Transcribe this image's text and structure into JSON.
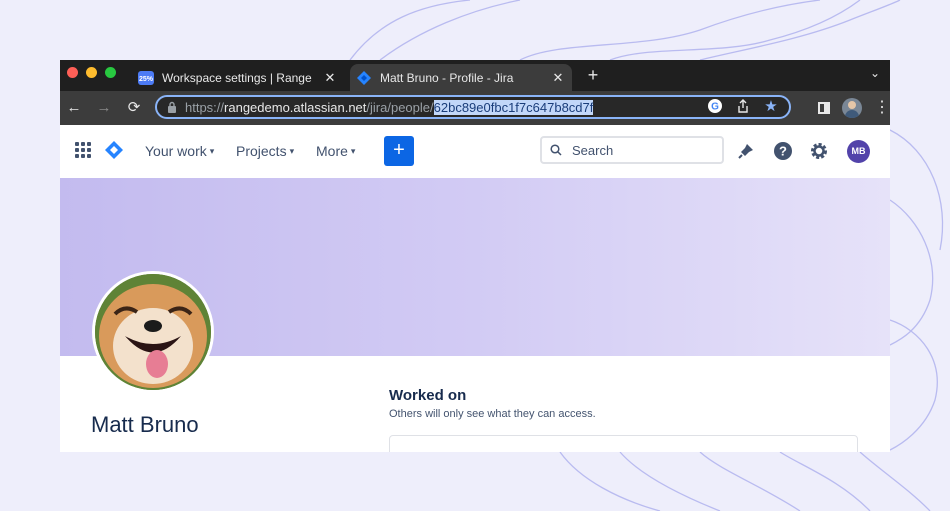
{
  "browser": {
    "tabs": [
      {
        "title": "Workspace settings | Range",
        "favicon": "range-logo-icon",
        "close": "✕"
      },
      {
        "title": "Matt Bruno - Profile - Jira",
        "favicon": "jira-logo-icon",
        "close": "✕"
      }
    ],
    "new_tab": "+",
    "tab_search": "⌄",
    "url": {
      "scheme": "https://",
      "host": "rangedemo.atlassian.net",
      "path": "/jira/people/",
      "selected": "62bc89e0fbc1f7c647b8cd7f"
    },
    "colors": {
      "tab_strip": "#1f1f1f",
      "toolbar": "#3c3c3c",
      "omnibox_border": "#8ab4f8"
    }
  },
  "jira_nav": {
    "your_work": "Your work",
    "projects": "Projects",
    "more": "More",
    "create": "+",
    "search_placeholder": "Search",
    "avatar_initials": "MB",
    "colors": {
      "create_button": "#0c66e4",
      "avatar": "#5243aa"
    }
  },
  "profile": {
    "name": "Matt Bruno",
    "worked_on": {
      "title": "Worked on",
      "subtitle": "Others will only see what they can access."
    },
    "colors": {
      "banner_start": "#c3bbef",
      "banner_end": "#e6e2f9"
    }
  }
}
